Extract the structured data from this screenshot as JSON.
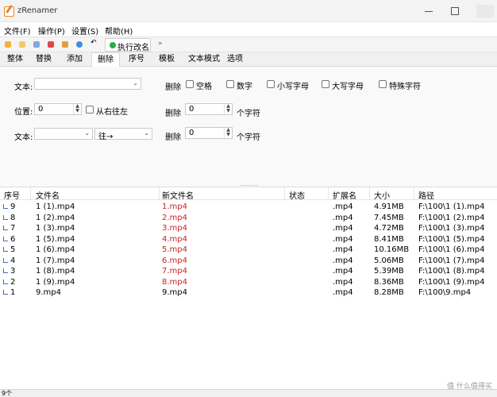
{
  "app": {
    "title": "zRenamer"
  },
  "menu": [
    "文件(F)",
    "操作(P)",
    "设置(S)",
    "帮助(H)"
  ],
  "toolbar": {
    "execute_label": "执行改名",
    "more": "»"
  },
  "tabs": [
    "整体",
    "替换",
    "添加",
    "删除",
    "序号",
    "模板",
    "文本模式",
    "选项"
  ],
  "active_tab": 3,
  "delete_panel": {
    "text_label": "文本:",
    "text_value": "",
    "delete_label": "删除",
    "checkboxes": [
      "空格",
      "数字",
      "小写字母",
      "大写字母",
      "特殊字符"
    ],
    "position_label": "位置:",
    "position_value": "0",
    "from_right_label": "从右往左",
    "delete_count_1": "0",
    "chars_label": "个字符",
    "text2_label": "文本:",
    "text2_value": "",
    "direction_value": "往→",
    "delete_count_2": "0"
  },
  "columns": [
    "序号",
    "文件名",
    "新文件名",
    "状态",
    "扩展名",
    "大小",
    "路径"
  ],
  "rows": [
    {
      "index": "9",
      "name": "1 (1).mp4",
      "newname": "1.mp4",
      "status": "",
      "ext": ".mp4",
      "size": "4.91MB",
      "path": "F:\\100\\1 (1).mp4"
    },
    {
      "index": "8",
      "name": "1 (2).mp4",
      "newname": "2.mp4",
      "status": "",
      "ext": ".mp4",
      "size": "7.45MB",
      "path": "F:\\100\\1 (2).mp4"
    },
    {
      "index": "7",
      "name": "1 (3).mp4",
      "newname": "3.mp4",
      "status": "",
      "ext": ".mp4",
      "size": "4.72MB",
      "path": "F:\\100\\1 (3).mp4"
    },
    {
      "index": "6",
      "name": "1 (5).mp4",
      "newname": "4.mp4",
      "status": "",
      "ext": ".mp4",
      "size": "8.41MB",
      "path": "F:\\100\\1 (5).mp4"
    },
    {
      "index": "5",
      "name": "1 (6).mp4",
      "newname": "5.mp4",
      "status": "",
      "ext": ".mp4",
      "size": "10.16MB",
      "path": "F:\\100\\1 (6).mp4"
    },
    {
      "index": "4",
      "name": "1 (7).mp4",
      "newname": "6.mp4",
      "status": "",
      "ext": ".mp4",
      "size": "5.06MB",
      "path": "F:\\100\\1 (7).mp4"
    },
    {
      "index": "3",
      "name": "1 (8).mp4",
      "newname": "7.mp4",
      "status": "",
      "ext": ".mp4",
      "size": "5.39MB",
      "path": "F:\\100\\1 (8).mp4"
    },
    {
      "index": "2",
      "name": "1 (9).mp4",
      "newname": "8.mp4",
      "status": "",
      "ext": ".mp4",
      "size": "8.36MB",
      "path": "F:\\100\\1 (9).mp4"
    },
    {
      "index": "1",
      "name": "9.mp4",
      "newname": "9.mp4",
      "status": "",
      "ext": ".mp4",
      "size": "8.28MB",
      "path": "F:\\100\\9.mp4",
      "unchanged": true
    }
  ],
  "status": {
    "count": "9个"
  },
  "watermark": "值 什么值得买",
  "colors": {
    "renamed": "#d02020",
    "execute_dot": "#22b14c",
    "app_icon": "#e8892a"
  },
  "icons": [
    "open-folder-icon",
    "add-files-icon",
    "copy-icon",
    "remove-icon",
    "save-icon",
    "settings-icon",
    "undo-icon",
    "execute-dot-icon"
  ]
}
